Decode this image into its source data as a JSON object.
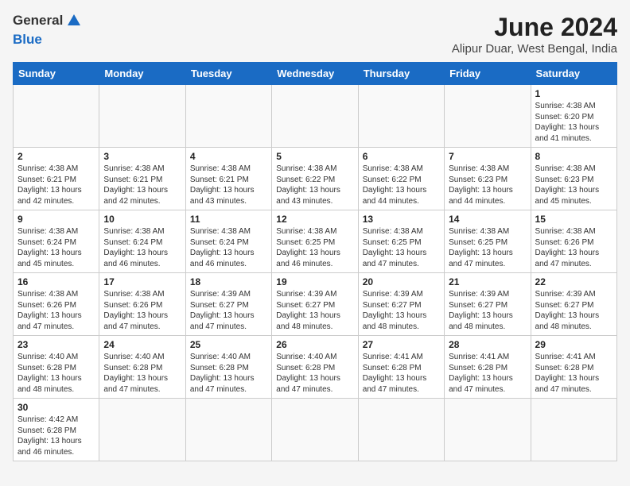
{
  "header": {
    "logo_text_1": "General",
    "logo_text_2": "Blue",
    "title": "June 2024",
    "subtitle": "Alipur Duar, West Bengal, India"
  },
  "weekdays": [
    "Sunday",
    "Monday",
    "Tuesday",
    "Wednesday",
    "Thursday",
    "Friday",
    "Saturday"
  ],
  "weeks": [
    [
      {
        "day": "",
        "info": ""
      },
      {
        "day": "",
        "info": ""
      },
      {
        "day": "",
        "info": ""
      },
      {
        "day": "",
        "info": ""
      },
      {
        "day": "",
        "info": ""
      },
      {
        "day": "",
        "info": ""
      },
      {
        "day": "1",
        "info": "Sunrise: 4:38 AM\nSunset: 6:20 PM\nDaylight: 13 hours and 41 minutes."
      }
    ],
    [
      {
        "day": "2",
        "info": "Sunrise: 4:38 AM\nSunset: 6:21 PM\nDaylight: 13 hours and 42 minutes."
      },
      {
        "day": "3",
        "info": "Sunrise: 4:38 AM\nSunset: 6:21 PM\nDaylight: 13 hours and 42 minutes."
      },
      {
        "day": "4",
        "info": "Sunrise: 4:38 AM\nSunset: 6:21 PM\nDaylight: 13 hours and 43 minutes."
      },
      {
        "day": "5",
        "info": "Sunrise: 4:38 AM\nSunset: 6:22 PM\nDaylight: 13 hours and 43 minutes."
      },
      {
        "day": "6",
        "info": "Sunrise: 4:38 AM\nSunset: 6:22 PM\nDaylight: 13 hours and 44 minutes."
      },
      {
        "day": "7",
        "info": "Sunrise: 4:38 AM\nSunset: 6:23 PM\nDaylight: 13 hours and 44 minutes."
      },
      {
        "day": "8",
        "info": "Sunrise: 4:38 AM\nSunset: 6:23 PM\nDaylight: 13 hours and 45 minutes."
      }
    ],
    [
      {
        "day": "9",
        "info": "Sunrise: 4:38 AM\nSunset: 6:24 PM\nDaylight: 13 hours and 45 minutes."
      },
      {
        "day": "10",
        "info": "Sunrise: 4:38 AM\nSunset: 6:24 PM\nDaylight: 13 hours and 46 minutes."
      },
      {
        "day": "11",
        "info": "Sunrise: 4:38 AM\nSunset: 6:24 PM\nDaylight: 13 hours and 46 minutes."
      },
      {
        "day": "12",
        "info": "Sunrise: 4:38 AM\nSunset: 6:25 PM\nDaylight: 13 hours and 46 minutes."
      },
      {
        "day": "13",
        "info": "Sunrise: 4:38 AM\nSunset: 6:25 PM\nDaylight: 13 hours and 47 minutes."
      },
      {
        "day": "14",
        "info": "Sunrise: 4:38 AM\nSunset: 6:25 PM\nDaylight: 13 hours and 47 minutes."
      },
      {
        "day": "15",
        "info": "Sunrise: 4:38 AM\nSunset: 6:26 PM\nDaylight: 13 hours and 47 minutes."
      }
    ],
    [
      {
        "day": "16",
        "info": "Sunrise: 4:38 AM\nSunset: 6:26 PM\nDaylight: 13 hours and 47 minutes."
      },
      {
        "day": "17",
        "info": "Sunrise: 4:38 AM\nSunset: 6:26 PM\nDaylight: 13 hours and 47 minutes."
      },
      {
        "day": "18",
        "info": "Sunrise: 4:39 AM\nSunset: 6:27 PM\nDaylight: 13 hours and 47 minutes."
      },
      {
        "day": "19",
        "info": "Sunrise: 4:39 AM\nSunset: 6:27 PM\nDaylight: 13 hours and 48 minutes."
      },
      {
        "day": "20",
        "info": "Sunrise: 4:39 AM\nSunset: 6:27 PM\nDaylight: 13 hours and 48 minutes."
      },
      {
        "day": "21",
        "info": "Sunrise: 4:39 AM\nSunset: 6:27 PM\nDaylight: 13 hours and 48 minutes."
      },
      {
        "day": "22",
        "info": "Sunrise: 4:39 AM\nSunset: 6:27 PM\nDaylight: 13 hours and 48 minutes."
      }
    ],
    [
      {
        "day": "23",
        "info": "Sunrise: 4:40 AM\nSunset: 6:28 PM\nDaylight: 13 hours and 48 minutes."
      },
      {
        "day": "24",
        "info": "Sunrise: 4:40 AM\nSunset: 6:28 PM\nDaylight: 13 hours and 47 minutes."
      },
      {
        "day": "25",
        "info": "Sunrise: 4:40 AM\nSunset: 6:28 PM\nDaylight: 13 hours and 47 minutes."
      },
      {
        "day": "26",
        "info": "Sunrise: 4:40 AM\nSunset: 6:28 PM\nDaylight: 13 hours and 47 minutes."
      },
      {
        "day": "27",
        "info": "Sunrise: 4:41 AM\nSunset: 6:28 PM\nDaylight: 13 hours and 47 minutes."
      },
      {
        "day": "28",
        "info": "Sunrise: 4:41 AM\nSunset: 6:28 PM\nDaylight: 13 hours and 47 minutes."
      },
      {
        "day": "29",
        "info": "Sunrise: 4:41 AM\nSunset: 6:28 PM\nDaylight: 13 hours and 47 minutes."
      }
    ],
    [
      {
        "day": "30",
        "info": "Sunrise: 4:42 AM\nSunset: 6:28 PM\nDaylight: 13 hours and 46 minutes."
      },
      {
        "day": "",
        "info": ""
      },
      {
        "day": "",
        "info": ""
      },
      {
        "day": "",
        "info": ""
      },
      {
        "day": "",
        "info": ""
      },
      {
        "day": "",
        "info": ""
      },
      {
        "day": "",
        "info": ""
      }
    ]
  ]
}
